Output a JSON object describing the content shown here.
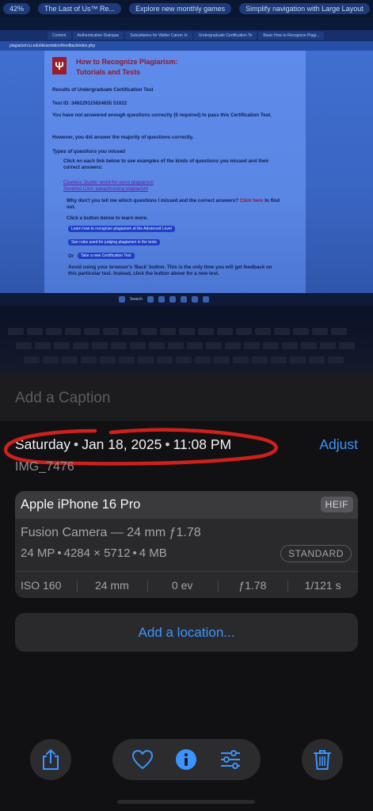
{
  "photo": {
    "browser_top_items": [
      "42%",
      "The Last of Us™ Re...",
      "Explore new monthly games",
      "Simplify navigation with Large Layout"
    ],
    "tabs": [
      "Content",
      "Authentication Dialogue",
      "Subsidiaries for Walter Career In",
      "Undergraduate Certification Te",
      "Basic How to Recognize Plagi..."
    ],
    "url": "plagiarism.iu.edu/dissertation/feedbackindex.php",
    "page": {
      "logo": "Ψ",
      "title_line1": "How to Recognize Plagiarism:",
      "title_line2": "Tutorials and Tests",
      "results_heading": "Results of Undergraduate Certification Test",
      "test_id": "Test ID: 346229115624655 51022",
      "not_enough": "You have not answered enough questions correctly (9 required) to pass this Certification Test.",
      "majority": "However, you did answer the majority of questions correctly.",
      "types_heading": "Types of questions you missed",
      "click_each": "Click on each link below to see examples of the kinds of questions you missed and their correct answers:",
      "link1": "Clueless Quote: word-for-word plagiarism",
      "link2": "Severed CAA: paraphrasing plagiarism",
      "why_dont": "Why don't you tell me which questions I missed and the correct answers?",
      "click_here": "Click here",
      "find_out": "to find out.",
      "click_button": "Click a button below to learn more.",
      "btn1": "Learn how to recognize plagiarism at the Advanced Level",
      "btn2": "See rules used for judging plagiarism in the tests",
      "or": "Or",
      "btn3": "Take a new Certification Test",
      "avoid": "Avoid using your browser's 'Back' button. This is the only time you will get feedback on this particular test. Instead, click the button above for a new test."
    },
    "taskbar_search": "Search"
  },
  "caption_placeholder": "Add a Caption",
  "date": {
    "day": "Saturday",
    "date": "Jan 18, 2025",
    "time": "11:08 PM",
    "separator": "•"
  },
  "adjust_label": "Adjust",
  "filename": "IMG_7476",
  "camera": {
    "device": "Apple iPhone 16 Pro",
    "format": "HEIF",
    "lens": "Fusion Camera — 24 mm ƒ1.78",
    "megapixels": "24 MP",
    "resolution": "4284 × 5712",
    "size": "4 MB",
    "style": "STANDARD",
    "exif": [
      "ISO 160",
      "24 mm",
      "0 ev",
      "ƒ1.78",
      "1/121 s"
    ]
  },
  "location_label": "Add a location...",
  "toolbar": {
    "share": "share-icon",
    "favorite": "heart-icon",
    "info": "info-icon",
    "edit": "sliders-icon",
    "delete": "trash-icon"
  },
  "colors": {
    "accent": "#3b94ff",
    "annotation": "#d0201c"
  }
}
